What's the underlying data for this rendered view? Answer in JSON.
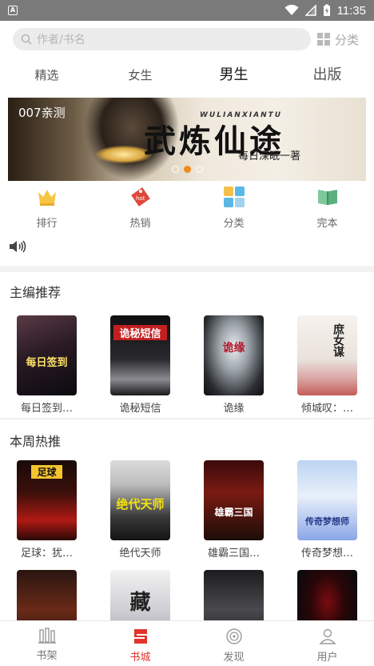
{
  "status": {
    "time": "11:35"
  },
  "search": {
    "placeholder": "作者/书名",
    "category_label": "分类"
  },
  "tabs": [
    {
      "label": "精选"
    },
    {
      "label": "女生"
    },
    {
      "label": "男生"
    },
    {
      "label": "出版"
    }
  ],
  "banner": {
    "tag": "007亲测",
    "title": "武炼仙途",
    "subtitle": "WULIANXIANTU",
    "slogan": "每日深眠一著",
    "active_dot": 2
  },
  "quick_links": [
    {
      "label": "排行",
      "icon": "crown-icon"
    },
    {
      "label": "热销",
      "icon": "hot-tag-icon"
    },
    {
      "label": "分类",
      "icon": "grid-icon"
    },
    {
      "label": "完本",
      "icon": "open-book-icon"
    }
  ],
  "sections": {
    "editor_pick": {
      "title": "主编推荐",
      "books": [
        {
          "title": "每日签到…",
          "cover_text": "每日签到"
        },
        {
          "title": "诡秘短信",
          "cover_text": "诡秘短信"
        },
        {
          "title": "诡缘",
          "cover_text": "诡缘"
        },
        {
          "title": "倾城叹：…",
          "cover_text": "庶女谋"
        }
      ]
    },
    "weekly_hot": {
      "title": "本周热推",
      "books": [
        {
          "title": "足球：犹…",
          "cover_text": "足球"
        },
        {
          "title": "绝代天师",
          "cover_text": "绝代天师"
        },
        {
          "title": "雄霸三国…",
          "cover_text": "雄霸三国"
        },
        {
          "title": "传奇梦想…",
          "cover_text": "传奇梦想师"
        }
      ],
      "more_books": [
        {
          "cover_text": ""
        },
        {
          "cover_text": "藏"
        },
        {
          "cover_text": ""
        },
        {
          "cover_text": ""
        }
      ]
    }
  },
  "bottom_nav": [
    {
      "label": "书架"
    },
    {
      "label": "书城"
    },
    {
      "label": "发现"
    },
    {
      "label": "用户"
    }
  ],
  "colors": {
    "accent": "#e0342c",
    "dot_active": "#f08a1e"
  }
}
